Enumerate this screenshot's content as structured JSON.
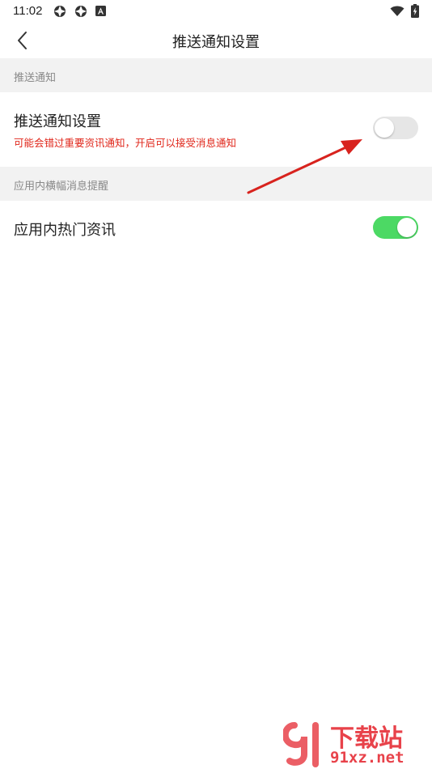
{
  "status_bar": {
    "time": "11:02"
  },
  "header": {
    "title": "推送通知设置",
    "back_icon": "chevron-left-icon"
  },
  "sections": [
    {
      "header": "推送通知",
      "item": {
        "title": "推送通知设置",
        "subtitle": "可能会错过重要资讯通知，开启可以接受消息通知",
        "toggle_on": false
      }
    },
    {
      "header": "应用内横幅消息提醒",
      "item": {
        "title": "应用内热门资讯",
        "toggle_on": true
      }
    }
  ],
  "watermark": {
    "brand": "下载站",
    "domain": "91xz.net"
  },
  "colors": {
    "toggle_on": "#4cd964",
    "toggle_off": "#e6e6e6",
    "warning_text": "#e0271b",
    "section_bg": "#f2f2f2",
    "annotation_arrow": "#d8231e",
    "watermark": "#e8424a"
  }
}
